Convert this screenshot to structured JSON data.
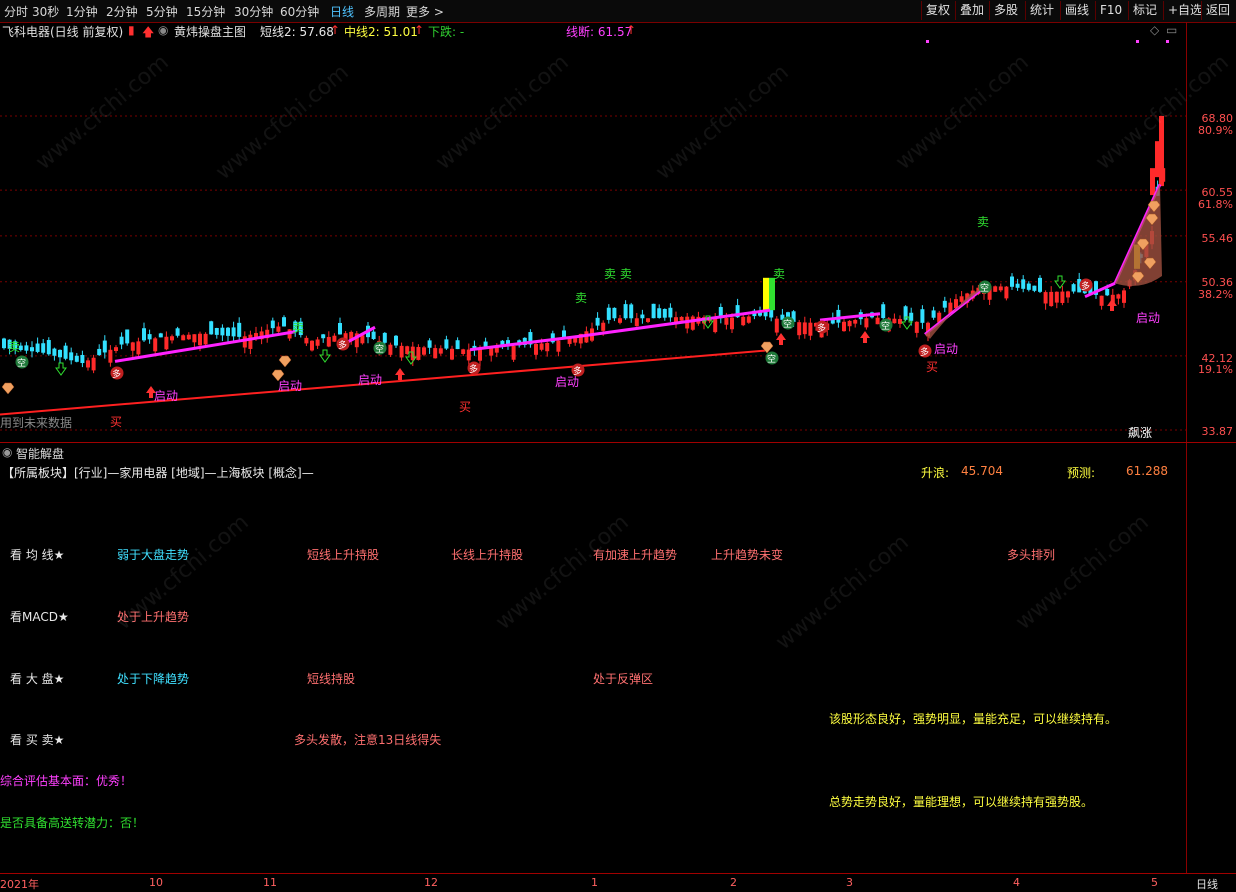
{
  "toolbar": {
    "periods": [
      "分时",
      "30秒",
      "1分钟",
      "2分钟",
      "5分钟",
      "15分钟",
      "30分钟",
      "60分钟",
      "日线",
      "多周期",
      "更多 >"
    ],
    "active_period": "日线",
    "right_buttons": [
      "复权",
      "叠加",
      "多股",
      "统计",
      "画线",
      "F10",
      "标记",
      "+自选",
      "返回"
    ]
  },
  "chart_header": {
    "stock": "飞科电器(日线 前复权)",
    "indicator": "黄炜操盘主图",
    "short_line": "短线2: 57.68",
    "mid_line": "中线2: 51.01",
    "down_trend": "下跌: -",
    "line_break": "线断: 61.57"
  },
  "price_axis": {
    "labels": [
      "68.80",
      "80.9%",
      "60.55",
      "61.8%",
      "55.46",
      "50.36",
      "38.2%",
      "42.12",
      "19.1%",
      "33.87"
    ]
  },
  "chart_labels": {
    "sell": "卖",
    "sell_double": "卖 卖",
    "buy": "买",
    "launch": "启动",
    "empty": "空",
    "bull": "多",
    "future_data": "用到未来数据",
    "surge": "飙涨"
  },
  "chart_data": {
    "type": "candlestick",
    "title": "飞科电器(日线 前复权)",
    "x_ticks": [
      "2021年",
      "10",
      "11",
      "12",
      "1",
      "2",
      "3",
      "4",
      "5"
    ],
    "ylim": [
      33.87,
      68.8
    ],
    "y_ticks": [
      68.8,
      60.55,
      55.46,
      50.36,
      42.12,
      33.87
    ],
    "fib_labels": [
      "80.9%",
      "61.8%",
      "38.2%",
      "19.1%"
    ],
    "close_trend": [
      [
        0,
        43.0
      ],
      [
        40,
        42.5
      ],
      [
        80,
        41.3
      ],
      [
        120,
        43.4
      ],
      [
        160,
        44.2
      ],
      [
        200,
        44.6
      ],
      [
        240,
        44.2
      ],
      [
        280,
        45.5
      ],
      [
        310,
        43.8
      ],
      [
        350,
        44.8
      ],
      [
        390,
        43.3
      ],
      [
        430,
        43.0
      ],
      [
        470,
        42.8
      ],
      [
        510,
        43.2
      ],
      [
        550,
        43.6
      ],
      [
        580,
        44.6
      ],
      [
        610,
        46.3
      ],
      [
        650,
        46.3
      ],
      [
        690,
        46.5
      ],
      [
        720,
        46.3
      ],
      [
        760,
        46.6
      ],
      [
        790,
        45.9
      ],
      [
        830,
        45.7
      ],
      [
        870,
        46.4
      ],
      [
        900,
        46.2
      ],
      [
        925,
        45.7
      ],
      [
        950,
        48.2
      ],
      [
        980,
        49.9
      ],
      [
        1010,
        49.8
      ],
      [
        1040,
        49.2
      ],
      [
        1070,
        49.3
      ],
      [
        1100,
        48.8
      ],
      [
        1120,
        49.0
      ],
      [
        1135,
        52.0
      ],
      [
        1150,
        56.0
      ],
      [
        1160,
        63.0
      ]
    ]
  },
  "panel": {
    "title": "智能解盘",
    "sector": "【所属板块】[行业]—家用电器 [地域]—上海板块 [概念]—",
    "rise_label": "升浪:",
    "rise_value": "45.704",
    "predict_label": "预测:",
    "predict_value": "61.288",
    "rows": [
      {
        "label": "看 均 线★",
        "items": [
          "弱于大盘走势",
          "短线上升持股",
          "长线上升持股",
          "有加速上升趋势",
          "上升趋势未变",
          "多头排列"
        ]
      },
      {
        "label": "看MACD★",
        "items": [
          "处于上升趋势"
        ]
      },
      {
        "label": "看 大 盘★",
        "items": [
          "处于下降趋势",
          "短线持股",
          "处于反弹区"
        ]
      },
      {
        "label": "看 买 卖★",
        "items": [
          "多头发散，注意13日线得失"
        ]
      }
    ],
    "comment1": "该股形态良好，强势明显，量能充足，可以继续持有。",
    "fundamental": "综合评估基本面：优秀！",
    "comment2": "总势走势良好，量能理想，可以继续持有强势股。",
    "bonus": "是否具备高送转潜力：否！"
  },
  "date_axis": {
    "labels": [
      "2021年",
      "10",
      "11",
      "12",
      "1",
      "2",
      "3",
      "4",
      "5"
    ],
    "period_label": "日线"
  },
  "watermark": "www.cfchi.com",
  "colors": {
    "up": "#ff2a2a",
    "down": "#33e0ff",
    "trend_magenta": "#ff22ff",
    "support_red": "#ff2020",
    "grid": "#7a0000"
  }
}
